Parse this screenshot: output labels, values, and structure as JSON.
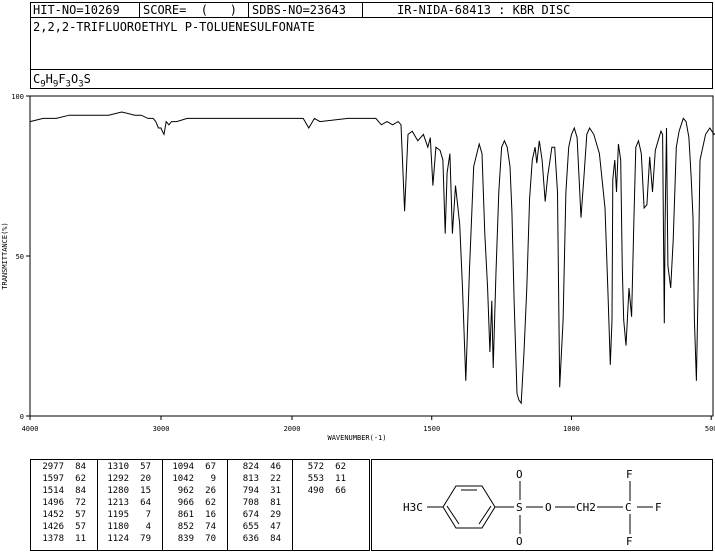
{
  "header": {
    "hit_no": "HIT-NO=10269",
    "score": "SCORE=  (   )",
    "sdbs_no": "SDBS-NO=23643",
    "ir_code": "IR-NIDA-68413 : KBR DISC",
    "compound_name": "2,2,2-TRIFLUOROETHYL P-TOLUENESULFONATE",
    "formula": "C9H9F3O3S"
  },
  "chart_data": {
    "type": "line",
    "xlabel": "WAVENUMBER(-1)",
    "ylabel": "TRANSMITTANCE(%)",
    "xlim": [
      4000,
      400
    ],
    "ylim": [
      0,
      100
    ],
    "x_ticks": [
      "4000",
      "3000",
      "2000",
      "1500",
      "1000",
      "500"
    ],
    "y_ticks": [
      "100",
      "50",
      "0"
    ],
    "series": [
      {
        "x": [
          4000,
          3900,
          3800,
          3700,
          3600,
          3500,
          3400,
          3300,
          3200,
          3150,
          3100,
          3060,
          3040,
          3020,
          3000,
          2990,
          2977,
          2960,
          2940,
          2920,
          2880,
          2800,
          2700,
          2600,
          2500,
          2400,
          2300,
          2200,
          2100,
          1960,
          1940,
          1920,
          1900,
          1800,
          1700,
          1680,
          1660,
          1640,
          1620,
          1610,
          1597,
          1585,
          1570,
          1550,
          1530,
          1514,
          1505,
          1496,
          1485,
          1470,
          1460,
          1452,
          1445,
          1435,
          1426,
          1415,
          1400,
          1390,
          1378,
          1365,
          1350,
          1330,
          1320,
          1310,
          1300,
          1292,
          1285,
          1280,
          1270,
          1260,
          1250,
          1240,
          1230,
          1220,
          1213,
          1205,
          1195,
          1188,
          1180,
          1170,
          1160,
          1150,
          1140,
          1130,
          1124,
          1115,
          1105,
          1094,
          1085,
          1070,
          1060,
          1050,
          1042,
          1030,
          1020,
          1010,
          1000,
          990,
          980,
          966,
          955,
          945,
          935,
          920,
          900,
          880,
          870,
          861,
          855,
          852,
          845,
          839,
          832,
          824,
          818,
          813,
          805,
          794,
          785,
          777,
          770,
          760,
          750,
          740,
          730,
          720,
          710,
          700,
          690,
          680,
          674,
          668,
          665,
          660,
          655,
          645,
          636,
          625,
          615,
          600,
          590,
          580,
          572,
          565,
          560,
          553,
          547,
          540,
          520,
          505,
          490,
          475,
          460,
          440,
          420,
          400
        ],
        "y": [
          92,
          93,
          93,
          94,
          94,
          94,
          94,
          95,
          94,
          94,
          93,
          93,
          92,
          90,
          90,
          89,
          88,
          92,
          91,
          92,
          92,
          93,
          93,
          93,
          93,
          93,
          93,
          93,
          93,
          93,
          90,
          93,
          92,
          93,
          93,
          91,
          92,
          91,
          92,
          91,
          64,
          88,
          89,
          86,
          88,
          84,
          87,
          72,
          84,
          83,
          80,
          57,
          76,
          82,
          57,
          72,
          60,
          40,
          11,
          46,
          78,
          85,
          82,
          57,
          40,
          20,
          36,
          15,
          45,
          70,
          84,
          86,
          84,
          78,
          64,
          35,
          7,
          5,
          4,
          20,
          40,
          68,
          80,
          84,
          79,
          86,
          80,
          67,
          75,
          84,
          84,
          70,
          9,
          30,
          70,
          84,
          88,
          90,
          87,
          62,
          75,
          88,
          90,
          88,
          82,
          65,
          40,
          16,
          30,
          74,
          80,
          70,
          85,
          80,
          46,
          30,
          22,
          40,
          31,
          60,
          84,
          86,
          82,
          65,
          66,
          81,
          70,
          83,
          86,
          89,
          88,
          29,
          60,
          90,
          47,
          40,
          55,
          84,
          89,
          93,
          92,
          87,
          75,
          62,
          30,
          11,
          40,
          80,
          88,
          90,
          88,
          89,
          90,
          89,
          87,
          86
        ]
      }
    ]
  },
  "peak_table": {
    "columns": [
      [
        [
          "2977",
          "84"
        ],
        [
          "1597",
          "62"
        ],
        [
          "1514",
          "84"
        ],
        [
          "1496",
          "72"
        ],
        [
          "1452",
          "57"
        ],
        [
          "1426",
          "57"
        ],
        [
          "1378",
          "11"
        ]
      ],
      [
        [
          "1310",
          "57"
        ],
        [
          "1292",
          "20"
        ],
        [
          "1280",
          "15"
        ],
        [
          "1213",
          "64"
        ],
        [
          "1195",
          "7"
        ],
        [
          "1180",
          "4"
        ],
        [
          "1124",
          "79"
        ]
      ],
      [
        [
          "1094",
          "67"
        ],
        [
          "1042",
          "9"
        ],
        [
          "962",
          "26"
        ],
        [
          "966",
          "62"
        ],
        [
          "861",
          "16"
        ],
        [
          "852",
          "74"
        ],
        [
          "839",
          "70"
        ]
      ],
      [
        [
          "824",
          "46"
        ],
        [
          "813",
          "22"
        ],
        [
          "794",
          "31"
        ],
        [
          "708",
          "81"
        ],
        [
          "674",
          "29"
        ],
        [
          "655",
          "47"
        ],
        [
          "636",
          "84"
        ]
      ],
      [
        [
          "572",
          "62"
        ],
        [
          "553",
          "11"
        ],
        [
          "490",
          "66"
        ]
      ]
    ]
  },
  "structure": {
    "methyl": "H3C",
    "sulfur": "S",
    "oxygen_top": "O",
    "oxygen_bottom": "O",
    "ester_oxygen": "O",
    "ch2": "CH2",
    "carbon": "C",
    "fluorine_top": "F",
    "fluorine_right": "F",
    "fluorine_bottom": "F"
  }
}
